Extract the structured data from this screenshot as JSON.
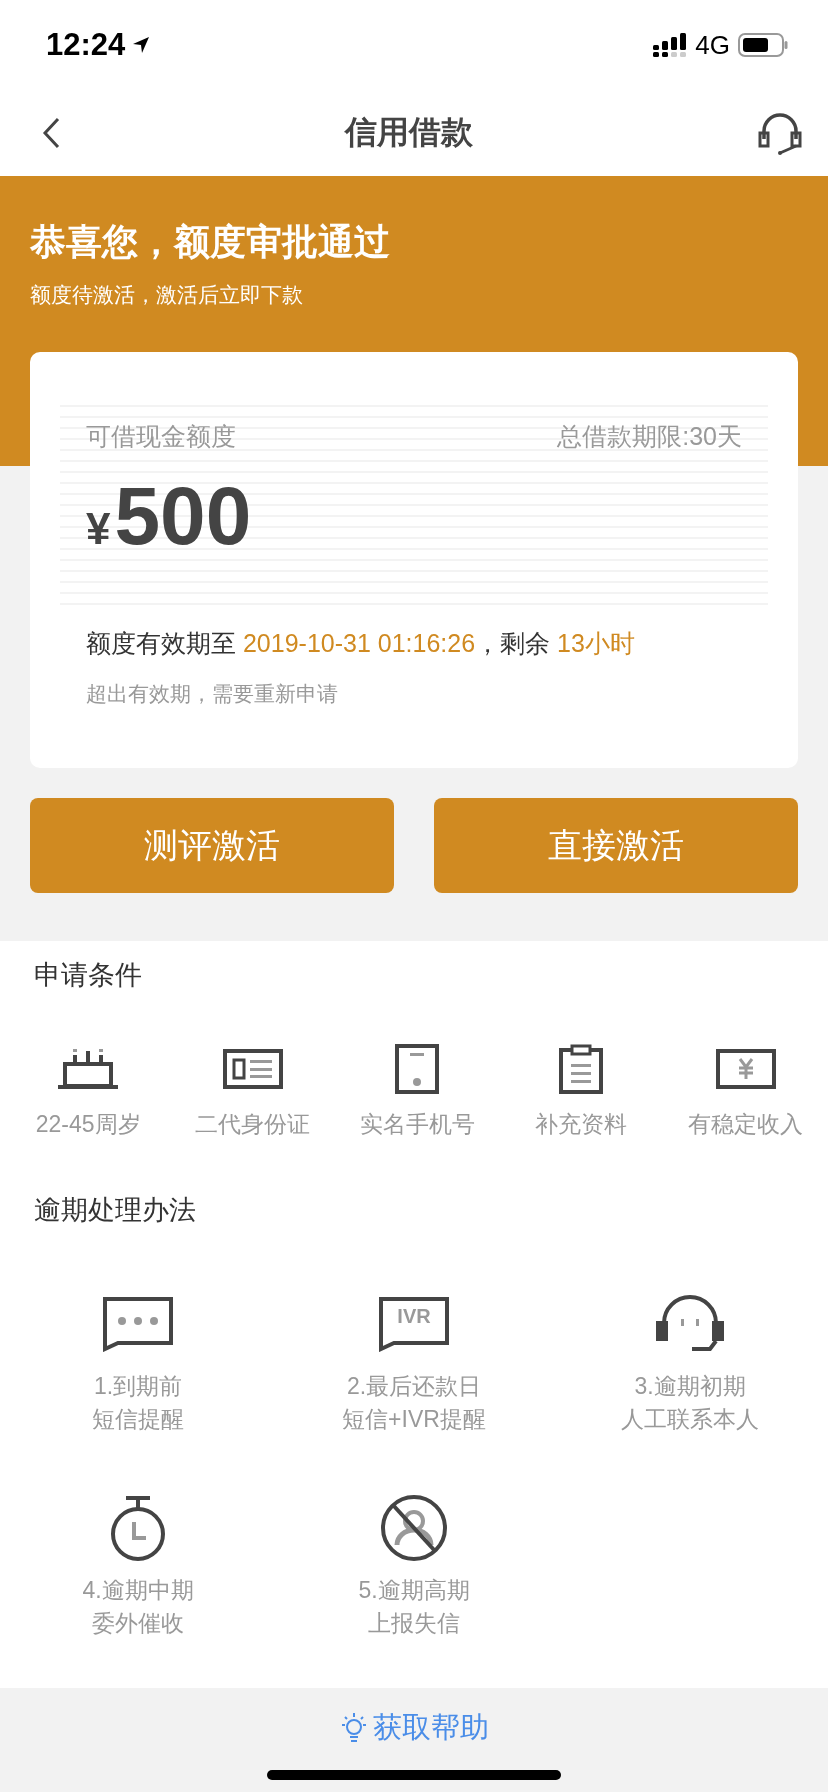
{
  "status_bar": {
    "time": "12:24",
    "network": "4G"
  },
  "nav": {
    "title": "信用借款"
  },
  "banner": {
    "title": "恭喜您，额度审批通过",
    "subtitle": "额度待激活，激活后立即下款"
  },
  "quota_card": {
    "label": "可借现金额度",
    "term": "总借款期限:30天",
    "currency": "¥",
    "amount": "500",
    "validity": [
      {
        "text": "额度有效期至 ",
        "highlight": false
      },
      {
        "text": "2019-10-31 01:16:26",
        "highlight": true
      },
      {
        "text": "，剩余 ",
        "highlight": false
      },
      {
        "text": "13小时",
        "highlight": true
      }
    ],
    "note": "超出有效期，需要重新申请"
  },
  "buttons": [
    {
      "label": "测评激活"
    },
    {
      "label": "直接激活"
    }
  ],
  "conditions": {
    "title": "申请条件",
    "items": [
      {
        "kind": "cake",
        "label": "22-45周岁"
      },
      {
        "kind": "idcard",
        "label": "二代身份证"
      },
      {
        "kind": "phone",
        "label": "实名手机号"
      },
      {
        "kind": "clipboard",
        "label": "补充资料"
      },
      {
        "kind": "income",
        "label": "有稳定收入"
      }
    ]
  },
  "overdue": {
    "title": "逾期处理办法",
    "items": [
      {
        "kind": "sms",
        "lines": [
          "1.到期前",
          "短信提醒"
        ]
      },
      {
        "kind": "ivr",
        "icon_text": "IVR",
        "lines": [
          "2.最后还款日",
          "短信+IVR提醒"
        ]
      },
      {
        "kind": "headset",
        "lines": [
          "3.逾期初期",
          "人工联系本人"
        ]
      },
      {
        "kind": "timer",
        "lines": [
          "4.逾期中期",
          "委外催收"
        ]
      },
      {
        "kind": "blocked",
        "lines": [
          "5.逾期高期",
          "上报失信"
        ]
      }
    ]
  },
  "footer": {
    "help": "获取帮助"
  }
}
